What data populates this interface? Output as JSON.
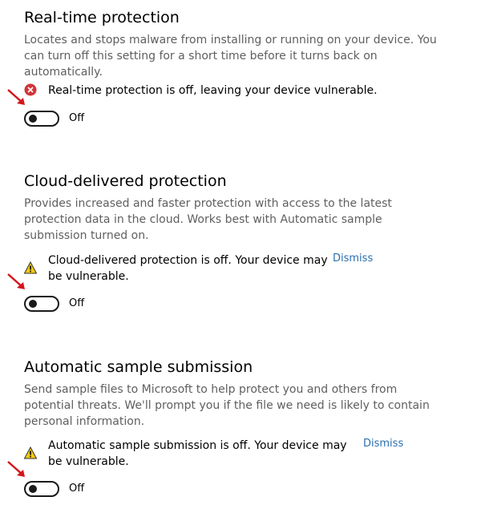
{
  "realtime": {
    "title": "Real-time protection",
    "description": "Locates and stops malware from installing or running on your device. You can turn off this setting for a short time before it turns back on automatically.",
    "status_text": "Real-time protection is off, leaving your device vulnerable.",
    "status_icon": "error-x-icon",
    "toggle_label": "Off",
    "toggle_on": false
  },
  "cloud": {
    "title": "Cloud-delivered protection",
    "description": "Provides increased and faster protection with access to the latest protection data in the cloud. Works best with Automatic sample submission turned on.",
    "status_text": "Cloud-delivered protection is off. Your device may be vulnerable.",
    "status_icon": "warning-icon",
    "dismiss_label": "Dismiss",
    "toggle_label": "Off",
    "toggle_on": false
  },
  "sample": {
    "title": "Automatic sample submission",
    "description": "Send sample files to Microsoft to help protect you and others from potential threats. We'll prompt you if the file we need is likely to contain personal information.",
    "status_text": "Automatic sample submission is off. Your device may be vulnerable.",
    "status_icon": "warning-icon",
    "dismiss_label": "Dismiss",
    "toggle_label": "Off",
    "toggle_on": false
  },
  "colors": {
    "accent_link": "#2a6fb0",
    "error": "#d13438",
    "warning": "#f2c811",
    "annotation_arrow": "#d4151b"
  }
}
